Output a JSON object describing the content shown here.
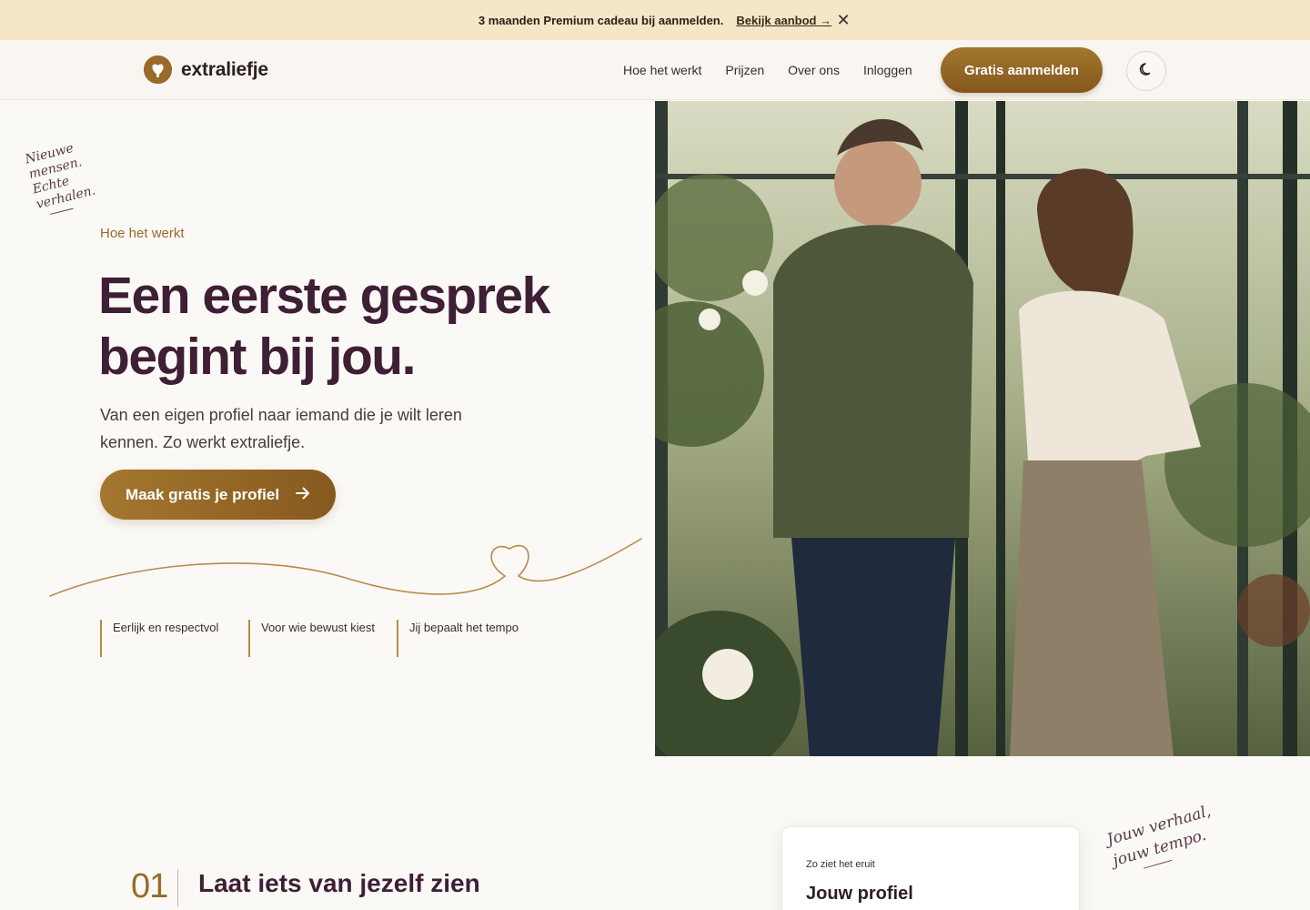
{
  "promo": {
    "message": "3 maanden Premium cadeau bij aanmelden.",
    "link_label": "Bekijk aanbod →",
    "close_label": "✕"
  },
  "header": {
    "brand": "extraliefje",
    "nav": [
      "Hoe het werkt",
      "Prijzen",
      "Over ons",
      "Inloggen"
    ],
    "cta_label": "Gratis aanmelden"
  },
  "hero": {
    "script_note": [
      "Nieuwe",
      "mensen.",
      "Echte",
      "verhalen."
    ],
    "eyebrow": "Hoe het werkt",
    "title_line1": "Een eerste gesprek",
    "title_line2": "begint bij jou.",
    "subtitle": "Van een eigen profiel naar iemand die je wilt leren kennen. Zo werkt extraliefje.",
    "cta_label": "Maak gratis je profiel",
    "features": [
      "Eerlijk en respectvol",
      "Voor wie bewust kiest",
      "Jij bepaalt het tempo"
    ]
  },
  "step": {
    "number": "01",
    "title": "Laat iets van jezelf zien"
  },
  "preview_card": {
    "eyebrow": "Zo ziet het eruit",
    "title": "Jouw profiel"
  },
  "script_note_2": [
    "Jouw verhaal,",
    "jouw tempo."
  ],
  "colors": {
    "accent": "#9a6a2b",
    "heading": "#3e1f36",
    "promo_bg": "#f4e6c6",
    "page_bg": "#fbf9f6"
  },
  "icons": {
    "close": "close-icon",
    "theme": "moon-icon",
    "arrow": "arrow-right-icon",
    "logo": "logo-mark-icon"
  }
}
